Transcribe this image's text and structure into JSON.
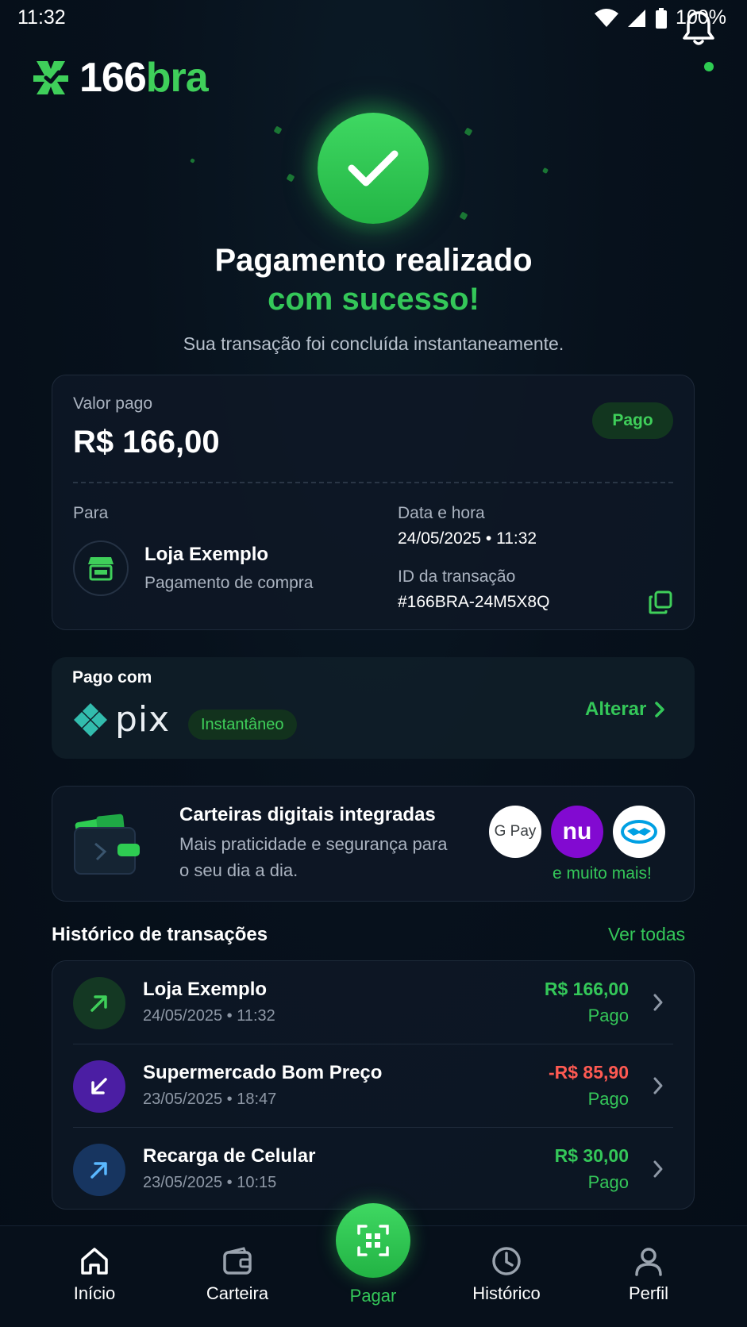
{
  "status_bar": {
    "time": "11:32",
    "battery": "100%"
  },
  "header": {
    "logo_text_1": "166",
    "logo_text_2": "bra"
  },
  "success": {
    "title_line1": "Pagamento realizado",
    "title_line2": "com sucesso!",
    "subtitle": "Sua transação foi concluída instantaneamente."
  },
  "payment": {
    "amount_label": "Valor pago",
    "amount": "R$ 166,00",
    "status": "Pago",
    "to_label": "Para",
    "merchant": "Loja Exemplo",
    "merchant_desc": "Pagamento de compra",
    "datetime_label": "Data e hora",
    "datetime": "24/05/2025 • 11:32",
    "txid_label": "ID da transação",
    "txid": "#166BRA-24M5X8Q"
  },
  "paid_with": {
    "title": "Pago com",
    "method": "pix",
    "badge": "Instantâneo",
    "change_label": "Alterar"
  },
  "wallets": {
    "title": "Carteiras digitais integradas",
    "description": "Mais praticidade e segurança para o seu dia a dia.",
    "gpay": "G Pay",
    "nubank": "nu",
    "more": "e muito mais!"
  },
  "history": {
    "title": "Histórico de transações",
    "see_all": "Ver todas",
    "items": [
      {
        "name": "Loja Exemplo",
        "date": "24/05/2025 • 11:32",
        "amount": "R$ 166,00",
        "status": "Pago",
        "amount_color": "#34c759"
      },
      {
        "name": "Supermercado Bom Preço",
        "date": "23/05/2025 • 18:47",
        "amount": "-R$ 85,90",
        "status": "Pago",
        "amount_color": "#ff5a52"
      },
      {
        "name": "Recarga de Celular",
        "date": "23/05/2025 • 10:15",
        "amount": "R$ 30,00",
        "status": "Pago",
        "amount_color": "#34c759"
      }
    ]
  },
  "nav": {
    "home": "Início",
    "wallet": "Carteira",
    "pay": "Pagar",
    "history": "Histórico",
    "profile": "Perfil"
  },
  "colors": {
    "accent": "#34c759",
    "negative": "#ff5a52",
    "background": "#07111c"
  }
}
